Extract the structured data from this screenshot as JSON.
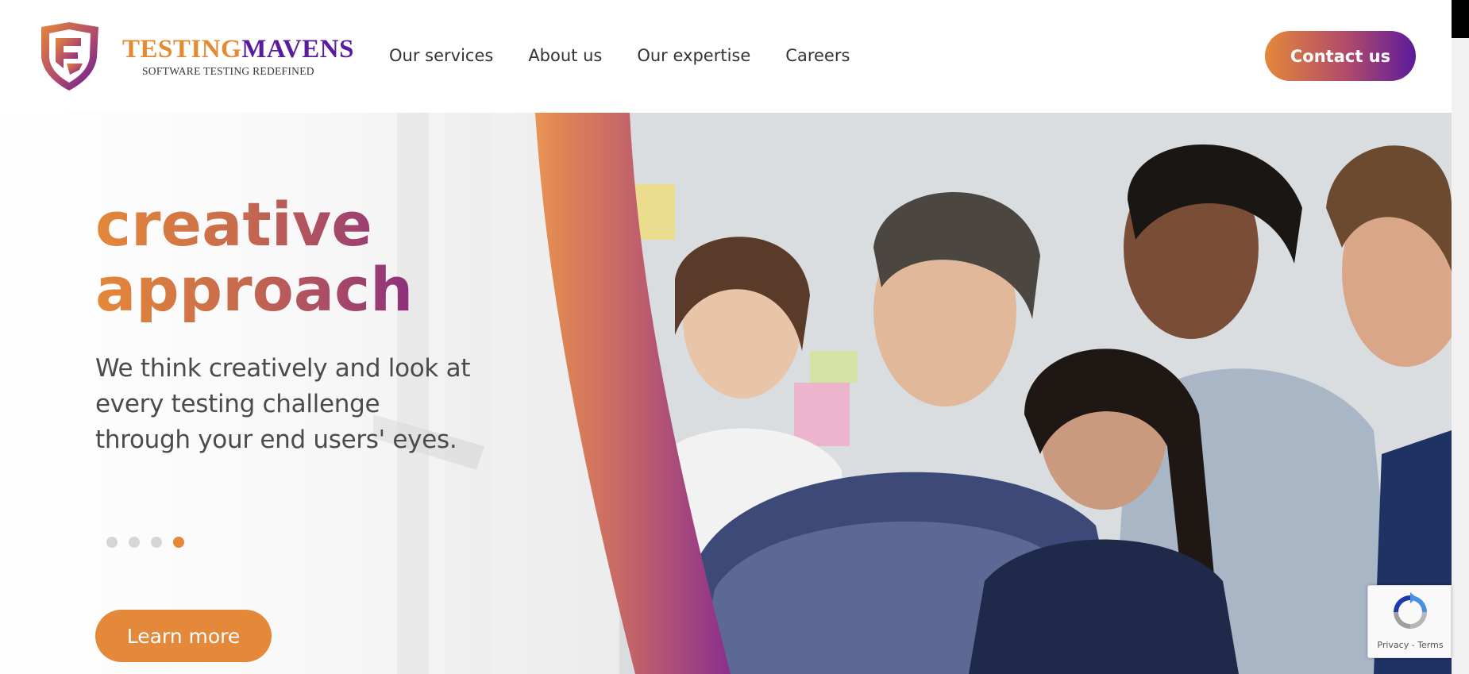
{
  "brand": {
    "name_part1": "TESTING",
    "name_part2": "MAVENS",
    "tagline": "SOFTWARE TESTING REDEFINED",
    "colors": {
      "orange": "#e4883a",
      "purple": "#5c1a9c"
    }
  },
  "nav": {
    "items": [
      "Our services",
      "About us",
      "Our expertise",
      "Careers"
    ]
  },
  "header": {
    "contact_label": "Contact us"
  },
  "hero": {
    "headline_line1": "creative",
    "headline_line2": "approach",
    "subtext": "We think creatively and look at every testing challenge through your end users' eyes.",
    "slides": {
      "count": 4,
      "active_index": 3
    },
    "cta_label": "Learn more"
  },
  "recaptcha": {
    "privacy": "Privacy",
    "separator": " - ",
    "terms": "Terms"
  }
}
